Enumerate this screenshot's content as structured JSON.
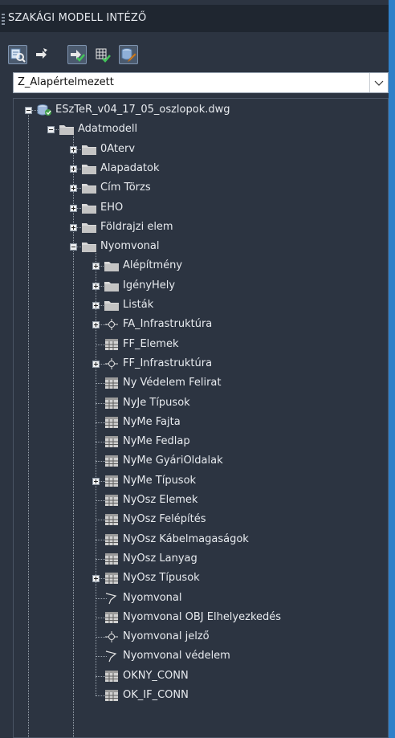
{
  "panel": {
    "title": "SZAKÁGI MODELL INTÉZŐ"
  },
  "toolbar": {
    "buttons": [
      {
        "icon": "search-database-icon",
        "active": true
      },
      {
        "icon": "arrows-icon",
        "active": false
      },
      {
        "icon": "check-arrows-icon",
        "active": true
      },
      {
        "icon": "grid-check-icon",
        "active": false
      },
      {
        "icon": "database-edit-icon",
        "active": true
      }
    ]
  },
  "dropdown": {
    "value": "Z_Alapértelmezett"
  },
  "tree": {
    "root": "ESzTeR_v04_17_05_oszlopok.dwg",
    "adatmodell": "Adatmodell",
    "level2": [
      "0Aterv",
      "Alapadatok",
      "Cím Törzs",
      "EHO",
      "Földrajzi elem",
      "Nyomvonal"
    ],
    "nyomvonal_children": [
      {
        "label": "Alépítmény",
        "type": "folder",
        "expander": "plus"
      },
      {
        "label": "IgényHely",
        "type": "folder",
        "expander": "plus"
      },
      {
        "label": "Listák",
        "type": "folder",
        "expander": "plus"
      },
      {
        "label": "FA_Infrastruktúra",
        "type": "point",
        "expander": "plus"
      },
      {
        "label": "FF_Elemek",
        "type": "table",
        "expander": "none"
      },
      {
        "label": "FF_Infrastruktúra",
        "type": "point",
        "expander": "plus"
      },
      {
        "label": "Ny Védelem Felirat",
        "type": "table",
        "expander": "none"
      },
      {
        "label": "NyJe Típusok",
        "type": "table",
        "expander": "none"
      },
      {
        "label": "NyMe Fajta",
        "type": "table",
        "expander": "none"
      },
      {
        "label": "NyMe Fedlap",
        "type": "table",
        "expander": "none"
      },
      {
        "label": "NyMe GyáriOldalak",
        "type": "table",
        "expander": "none"
      },
      {
        "label": "NyMe Típusok",
        "type": "table",
        "expander": "plus"
      },
      {
        "label": "NyOsz Elemek",
        "type": "table",
        "expander": "none"
      },
      {
        "label": "NyOsz Felépítés",
        "type": "table",
        "expander": "none"
      },
      {
        "label": "NyOsz Kábelmagaságok",
        "type": "table",
        "expander": "none"
      },
      {
        "label": "NyOsz Lanyag",
        "type": "table",
        "expander": "none"
      },
      {
        "label": "NyOsz Típusok",
        "type": "table",
        "expander": "plus"
      },
      {
        "label": "Nyomvonal",
        "type": "line",
        "expander": "none"
      },
      {
        "label": "Nyomvonal OBJ Elhelyezkedés",
        "type": "table",
        "expander": "none"
      },
      {
        "label": "Nyomvonal jelző",
        "type": "point",
        "expander": "none"
      },
      {
        "label": "Nyomvonal védelem",
        "type": "line",
        "expander": "none"
      },
      {
        "label": "OKNY_CONN",
        "type": "table",
        "expander": "none"
      },
      {
        "label": "OK_IF_CONN",
        "type": "table",
        "expander": "none"
      }
    ]
  }
}
